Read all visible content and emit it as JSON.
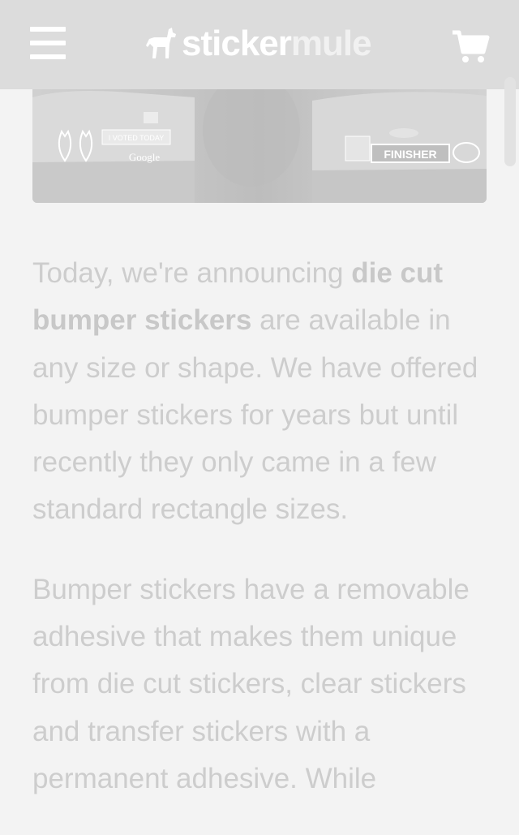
{
  "header": {
    "logo_text_primary": "sticker",
    "logo_text_secondary": "mule",
    "menu_icon": "hamburger-menu-icon",
    "cart_icon": "shopping-cart-icon",
    "background_color": "#dcdcdc"
  },
  "hero": {
    "sticker_voted": "I VOTED TODAY",
    "sticker_google": "Google",
    "sticker_finisher": "FINISHER"
  },
  "article": {
    "p1_intro": "Today, we're announcing ",
    "p1_bold": "die cut bumper stickers",
    "p1_rest": " are available in any size or shape. We have offered bumper stickers for years but until recently they only came in a few standard rectangle sizes.",
    "p2": "Bumper stickers have a removable adhesive that makes them unique from die cut stickers, clear stickers and transfer stickers with a permanent adhesive. While"
  },
  "colors": {
    "page_background": "#f3f3f3",
    "text": "#cdcdcd"
  }
}
